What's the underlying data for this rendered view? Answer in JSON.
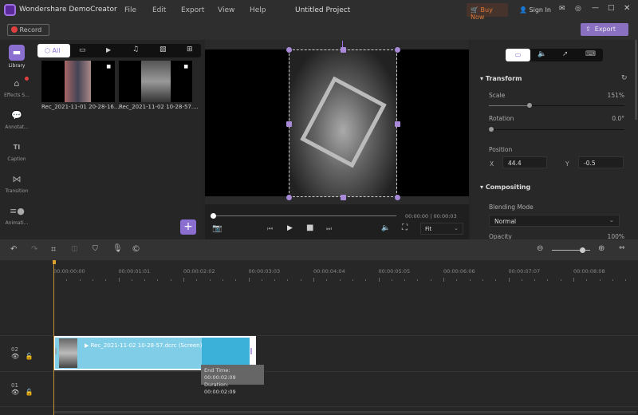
{
  "app": {
    "title": "Wondershare DemoCreator",
    "project": "Untitled Project",
    "menu": [
      "File",
      "Edit",
      "Export",
      "View",
      "Help"
    ],
    "buy_now": "Buy Now",
    "sign_in": "Sign In",
    "record": "Record",
    "export": "Export"
  },
  "sidebar": [
    {
      "label": "Library",
      "icon": "folder-icon",
      "active": true
    },
    {
      "label": "Effects S...",
      "icon": "store-icon",
      "badge": true
    },
    {
      "label": "Annotat...",
      "icon": "annotation-icon"
    },
    {
      "label": "Caption",
      "icon": "caption-icon"
    },
    {
      "label": "Transition",
      "icon": "transition-icon"
    },
    {
      "label": "Animati...",
      "icon": "animation-icon"
    }
  ],
  "media": {
    "tabs": [
      "All",
      "video",
      "screen",
      "audio",
      "image",
      "more"
    ],
    "items": [
      {
        "name": "Rec_2021-11-01 20-28-16...."
      },
      {
        "name": "Rec_2021-11-02 10-28-57...."
      }
    ]
  },
  "player": {
    "time": "00:00:00 | 00:00:03",
    "fit": "Fit",
    "progress": 0
  },
  "props": {
    "transform": "Transform",
    "scale_label": "Scale",
    "scale_value": "151%",
    "scale_level": 0.3,
    "rotation_label": "Rotation",
    "rotation_value": "0.0°",
    "rotation_level": 0,
    "position_label": "Position",
    "x_label": "X",
    "x": "44.4",
    "y_label": "Y",
    "y": "-0.5",
    "compositing": "Compositing",
    "blend_label": "Blending Mode",
    "blend": "Normal",
    "opacity_label": "Opacity",
    "opacity_value": "100%"
  },
  "timeline": {
    "ticks": [
      "00:00:00:00",
      "00:00:01:01",
      "00:00:02:02",
      "00:00:03:03",
      "00:00:04:04",
      "00:00:05:05",
      "00:00:06:06",
      "00:00:07:07",
      "00:00:08:08"
    ],
    "tracks": [
      "02",
      "01"
    ],
    "clip": "Rec_2021-11-02 10-28-57.dcrc (Screen)",
    "tooltip_end": "End Time: 00:00:02:09",
    "tooltip_duration": "Duration: 00:00:02:09"
  },
  "colors": {
    "accent": "#8a6fd1",
    "clip": "#7fcde6",
    "clip_dark": "#3bb1d9",
    "playhead": "#e0a030",
    "buy": "#e07a3a"
  }
}
